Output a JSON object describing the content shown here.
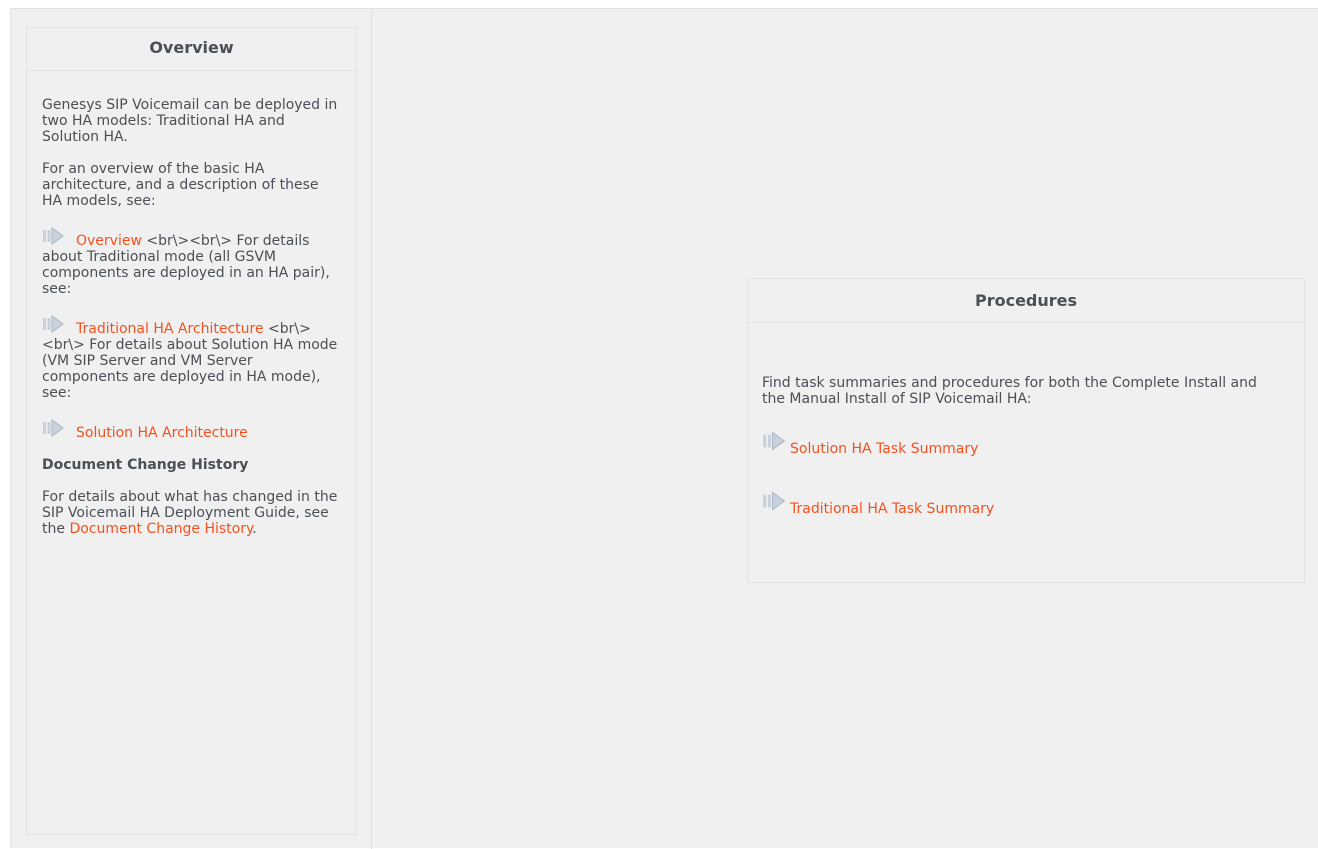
{
  "overview": {
    "title": "Overview",
    "intro": "Genesys SIP Voicemail can be deployed in two HA models: Traditional HA and Solution HA.",
    "arch_intro": "For an overview of the basic HA architecture, and a description of these HA models, see:",
    "link_overview": "Overview",
    "after_overview": " <br\\><br\\> For details about Traditional mode (all GSVM components are deployed in an HA pair), see:",
    "link_traditional": "Traditional HA Architecture",
    "after_traditional": " <br\\><br\\> For details about Solution HA mode (VM SIP Server and VM Server components are deployed in HA mode), see:",
    "link_solution": "Solution HA Architecture",
    "history_heading": "Document Change History",
    "history_text": "For details about what has changed in the SIP Voicemail HA Deployment Guide, see the ",
    "history_link": "Document Change History",
    "history_end": "."
  },
  "procedures": {
    "title": "Procedures",
    "intro": "Find task summaries and procedures for both the Complete Install and the Manual Install of SIP Voicemail HA:",
    "link_solution_summary": "Solution HA Task Summary",
    "link_traditional_summary": "Traditional HA Task Summary"
  },
  "icons": {
    "link_arrow": "arrow-right-icon"
  },
  "colors": {
    "link": "#f4511e",
    "text": "#4b4f56",
    "background": "#f0f0f0"
  }
}
